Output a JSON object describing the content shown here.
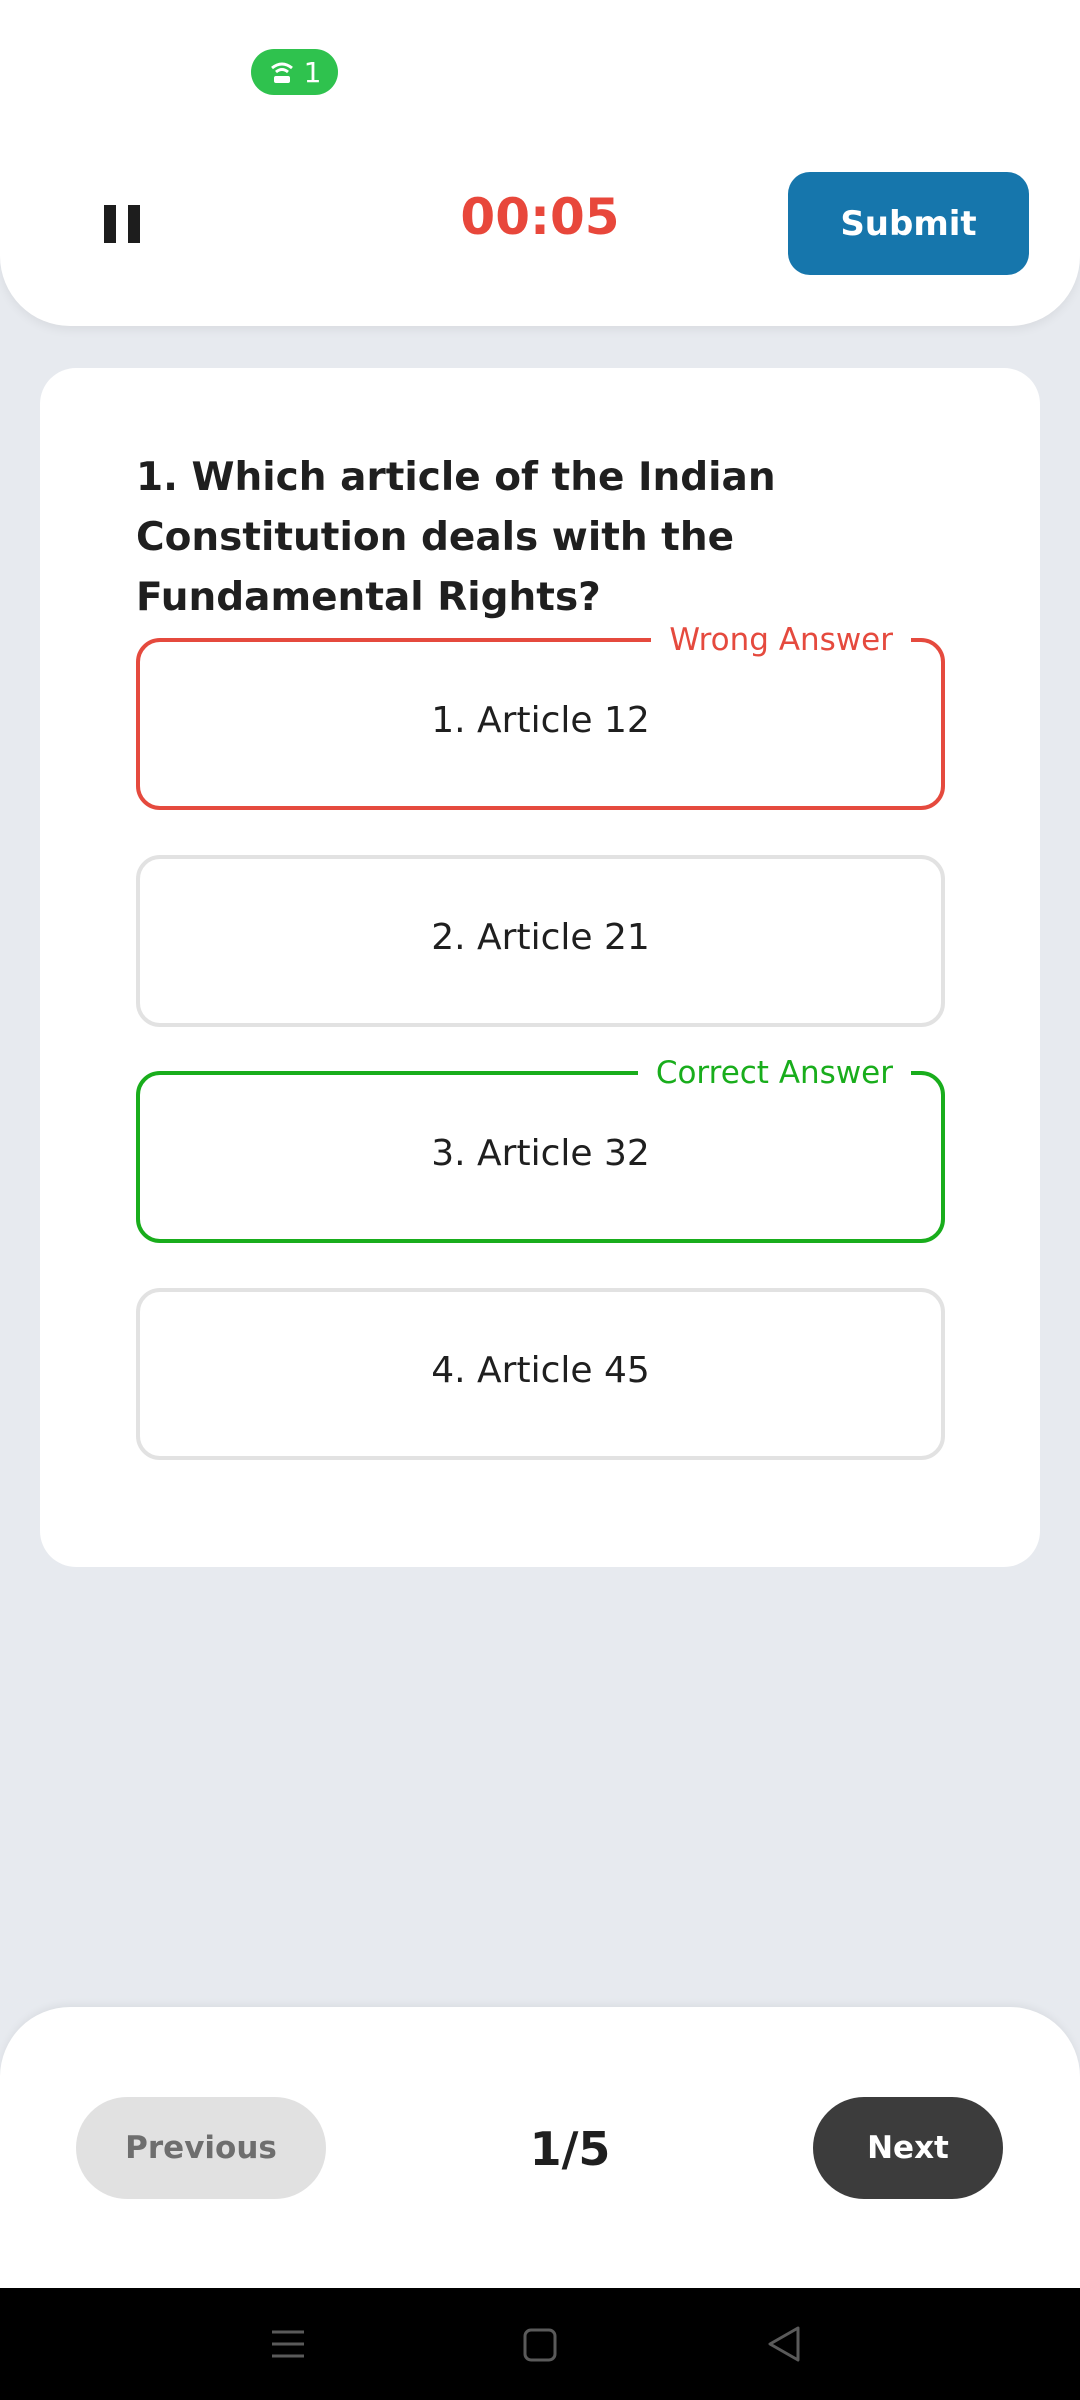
{
  "status_bar": {
    "hotspot_count": "1",
    "hotspot_icon": "hotspot-icon",
    "hotspot_color": "#2fc24e"
  },
  "header": {
    "pause_icon": "pause-icon",
    "timer": "00:05",
    "timer_color": "#e8473b",
    "submit_label": "Submit",
    "submit_color": "#1676ac"
  },
  "question": {
    "text": "1. Which article of the Indian Constitution deals with the Fundamental Rights?",
    "options": [
      {
        "label": "1. Article 12",
        "state": "wrong",
        "tag": "Wrong Answer"
      },
      {
        "label": "2. Article 21",
        "state": "neutral",
        "tag": ""
      },
      {
        "label": "3. Article 32",
        "state": "correct",
        "tag": "Correct Answer"
      },
      {
        "label": "4. Article 45",
        "state": "neutral",
        "tag": ""
      }
    ],
    "wrong_color": "#e54a3e",
    "correct_color": "#19ad1c"
  },
  "footer": {
    "previous_label": "Previous",
    "page_indicator": "1/5",
    "next_label": "Next"
  },
  "system_nav": {
    "icons": [
      "menu-icon",
      "home-icon",
      "back-icon"
    ]
  }
}
